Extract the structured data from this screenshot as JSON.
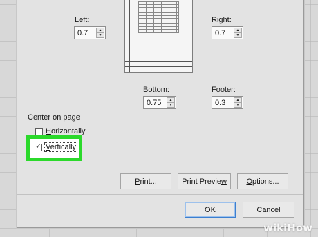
{
  "margins": {
    "left": {
      "label_pre": "",
      "label_u": "L",
      "label_post": "eft:",
      "value": "0.7"
    },
    "right": {
      "label_pre": "",
      "label_u": "R",
      "label_post": "ight:",
      "value": "0.7"
    },
    "bottom": {
      "label_pre": "",
      "label_u": "B",
      "label_post": "ottom:",
      "value": "0.75"
    },
    "footer": {
      "label_pre": "",
      "label_u": "F",
      "label_post": "ooter:",
      "value": "0.3"
    }
  },
  "center_on_page": {
    "title": "Center on page",
    "horizontally": {
      "label_u": "H",
      "label_post": "orizontally",
      "checked": false
    },
    "vertically": {
      "label_u": "V",
      "label_post": "ertically",
      "checked": true
    }
  },
  "buttons": {
    "print_pre": "",
    "print_u": "P",
    "print_post": "rint...",
    "print_preview_pre": "Print Previe",
    "print_preview_u": "w",
    "print_preview_post": "",
    "options_pre": "",
    "options_u": "O",
    "options_post": "ptions...",
    "ok": "OK",
    "cancel": "Cancel"
  },
  "watermark": {
    "pre": "wiki",
    "post": "How"
  },
  "icons": {
    "spin_up": "triangle-up",
    "spin_down": "triangle-down",
    "check": "check-mark"
  },
  "colors": {
    "highlight": "#2bd92b",
    "default_button_border": "#3c7fd0"
  }
}
